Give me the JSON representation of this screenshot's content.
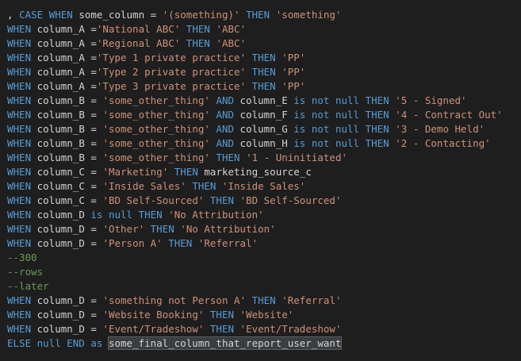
{
  "editor": {
    "lines": [
      [
        {
          "t": ", ",
          "c": "op"
        },
        {
          "t": "CASE WHEN",
          "c": "kw"
        },
        {
          "t": " some_column ",
          "c": "id"
        },
        {
          "t": "=",
          "c": "op"
        },
        {
          "t": " ",
          "c": "op"
        },
        {
          "t": "'(something)'",
          "c": "str"
        },
        {
          "t": " ",
          "c": "op"
        },
        {
          "t": "THEN",
          "c": "kw"
        },
        {
          "t": " ",
          "c": "op"
        },
        {
          "t": "'something'",
          "c": "str"
        }
      ],
      [
        {
          "t": "WHEN",
          "c": "kw"
        },
        {
          "t": " column_A ",
          "c": "id"
        },
        {
          "t": "=",
          "c": "op"
        },
        {
          "t": "'National ABC'",
          "c": "str"
        },
        {
          "t": " ",
          "c": "op"
        },
        {
          "t": "THEN",
          "c": "kw"
        },
        {
          "t": " ",
          "c": "op"
        },
        {
          "t": "'ABC'",
          "c": "str"
        }
      ],
      [
        {
          "t": "WHEN",
          "c": "kw"
        },
        {
          "t": " column_A ",
          "c": "id"
        },
        {
          "t": "=",
          "c": "op"
        },
        {
          "t": "'Regional ABC'",
          "c": "str"
        },
        {
          "t": " ",
          "c": "op"
        },
        {
          "t": "THEN",
          "c": "kw"
        },
        {
          "t": " ",
          "c": "op"
        },
        {
          "t": "'ABC'",
          "c": "str"
        }
      ],
      [
        {
          "t": "WHEN",
          "c": "kw"
        },
        {
          "t": " column_A ",
          "c": "id"
        },
        {
          "t": "=",
          "c": "op"
        },
        {
          "t": "'Type 1 private practice'",
          "c": "str"
        },
        {
          "t": " ",
          "c": "op"
        },
        {
          "t": "THEN",
          "c": "kw"
        },
        {
          "t": " ",
          "c": "op"
        },
        {
          "t": "'PP'",
          "c": "str"
        }
      ],
      [
        {
          "t": "WHEN",
          "c": "kw"
        },
        {
          "t": " column_A ",
          "c": "id"
        },
        {
          "t": "=",
          "c": "op"
        },
        {
          "t": "'Type 2 private practice'",
          "c": "str"
        },
        {
          "t": " ",
          "c": "op"
        },
        {
          "t": "THEN",
          "c": "kw"
        },
        {
          "t": " ",
          "c": "op"
        },
        {
          "t": "'PP'",
          "c": "str"
        }
      ],
      [
        {
          "t": "WHEN",
          "c": "kw"
        },
        {
          "t": " column_A ",
          "c": "id"
        },
        {
          "t": "=",
          "c": "op"
        },
        {
          "t": "'Type 3 private practice'",
          "c": "str"
        },
        {
          "t": " ",
          "c": "op"
        },
        {
          "t": "THEN",
          "c": "kw"
        },
        {
          "t": " ",
          "c": "op"
        },
        {
          "t": "'PP'",
          "c": "str"
        }
      ],
      [
        {
          "t": "WHEN",
          "c": "kw"
        },
        {
          "t": " column_B ",
          "c": "id"
        },
        {
          "t": "=",
          "c": "op"
        },
        {
          "t": " ",
          "c": "op"
        },
        {
          "t": "'some_other_thing'",
          "c": "str"
        },
        {
          "t": " ",
          "c": "op"
        },
        {
          "t": "AND",
          "c": "kw"
        },
        {
          "t": " column_E ",
          "c": "id"
        },
        {
          "t": "is not null",
          "c": "kw"
        },
        {
          "t": " ",
          "c": "op"
        },
        {
          "t": "THEN",
          "c": "kw"
        },
        {
          "t": " ",
          "c": "op"
        },
        {
          "t": "'5 - Signed'",
          "c": "str"
        }
      ],
      [
        {
          "t": "WHEN",
          "c": "kw"
        },
        {
          "t": " column_B ",
          "c": "id"
        },
        {
          "t": "=",
          "c": "op"
        },
        {
          "t": " ",
          "c": "op"
        },
        {
          "t": "'some_other_thing'",
          "c": "str"
        },
        {
          "t": " ",
          "c": "op"
        },
        {
          "t": "AND",
          "c": "kw"
        },
        {
          "t": " column_F ",
          "c": "id"
        },
        {
          "t": "is not null",
          "c": "kw"
        },
        {
          "t": " ",
          "c": "op"
        },
        {
          "t": "THEN",
          "c": "kw"
        },
        {
          "t": " ",
          "c": "op"
        },
        {
          "t": "'4 - Contract Out'",
          "c": "str"
        }
      ],
      [
        {
          "t": "WHEN",
          "c": "kw"
        },
        {
          "t": " column_B ",
          "c": "id"
        },
        {
          "t": "=",
          "c": "op"
        },
        {
          "t": " ",
          "c": "op"
        },
        {
          "t": "'some_other_thing'",
          "c": "str"
        },
        {
          "t": " ",
          "c": "op"
        },
        {
          "t": "AND",
          "c": "kw"
        },
        {
          "t": " column_G ",
          "c": "id"
        },
        {
          "t": "is not null",
          "c": "kw"
        },
        {
          "t": " ",
          "c": "op"
        },
        {
          "t": "THEN",
          "c": "kw"
        },
        {
          "t": " ",
          "c": "op"
        },
        {
          "t": "'3 - Demo Held'",
          "c": "str"
        }
      ],
      [
        {
          "t": "WHEN",
          "c": "kw"
        },
        {
          "t": " column_B ",
          "c": "id"
        },
        {
          "t": "=",
          "c": "op"
        },
        {
          "t": " ",
          "c": "op"
        },
        {
          "t": "'some_other_thing'",
          "c": "str"
        },
        {
          "t": " ",
          "c": "op"
        },
        {
          "t": "AND",
          "c": "kw"
        },
        {
          "t": " column_H ",
          "c": "id"
        },
        {
          "t": "is not null",
          "c": "kw"
        },
        {
          "t": " ",
          "c": "op"
        },
        {
          "t": "THEN",
          "c": "kw"
        },
        {
          "t": " ",
          "c": "op"
        },
        {
          "t": "'2 - Contacting'",
          "c": "str"
        }
      ],
      [
        {
          "t": "WHEN",
          "c": "kw"
        },
        {
          "t": " column_B ",
          "c": "id"
        },
        {
          "t": "=",
          "c": "op"
        },
        {
          "t": " ",
          "c": "op"
        },
        {
          "t": "'some_other_thing'",
          "c": "str"
        },
        {
          "t": " ",
          "c": "op"
        },
        {
          "t": "THEN",
          "c": "kw"
        },
        {
          "t": " ",
          "c": "op"
        },
        {
          "t": "'1 - Uninitiated'",
          "c": "str"
        }
      ],
      [
        {
          "t": "WHEN",
          "c": "kw"
        },
        {
          "t": " column_C ",
          "c": "id"
        },
        {
          "t": "=",
          "c": "op"
        },
        {
          "t": " ",
          "c": "op"
        },
        {
          "t": "'Marketing'",
          "c": "str"
        },
        {
          "t": " ",
          "c": "op"
        },
        {
          "t": "THEN",
          "c": "kw"
        },
        {
          "t": " marketing_source_c",
          "c": "id"
        }
      ],
      [
        {
          "t": "WHEN",
          "c": "kw"
        },
        {
          "t": " column_C ",
          "c": "id"
        },
        {
          "t": "=",
          "c": "op"
        },
        {
          "t": " ",
          "c": "op"
        },
        {
          "t": "'Inside Sales'",
          "c": "str"
        },
        {
          "t": " ",
          "c": "op"
        },
        {
          "t": "THEN",
          "c": "kw"
        },
        {
          "t": " ",
          "c": "op"
        },
        {
          "t": "'Inside Sales'",
          "c": "str"
        }
      ],
      [
        {
          "t": "WHEN",
          "c": "kw"
        },
        {
          "t": " column_C ",
          "c": "id"
        },
        {
          "t": "=",
          "c": "op"
        },
        {
          "t": " ",
          "c": "op"
        },
        {
          "t": "'BD Self-Sourced'",
          "c": "str"
        },
        {
          "t": " ",
          "c": "op"
        },
        {
          "t": "THEN",
          "c": "kw"
        },
        {
          "t": " ",
          "c": "op"
        },
        {
          "t": "'BD Self-Sourced'",
          "c": "str"
        }
      ],
      [
        {
          "t": "WHEN",
          "c": "kw"
        },
        {
          "t": " column_D ",
          "c": "id"
        },
        {
          "t": "is null",
          "c": "kw"
        },
        {
          "t": " ",
          "c": "op"
        },
        {
          "t": "THEN",
          "c": "kw"
        },
        {
          "t": " ",
          "c": "op"
        },
        {
          "t": "'No Attribution'",
          "c": "str"
        }
      ],
      [
        {
          "t": "WHEN",
          "c": "kw"
        },
        {
          "t": " column_D ",
          "c": "id"
        },
        {
          "t": "=",
          "c": "op"
        },
        {
          "t": " ",
          "c": "op"
        },
        {
          "t": "'Other'",
          "c": "str"
        },
        {
          "t": " ",
          "c": "op"
        },
        {
          "t": "THEN",
          "c": "kw"
        },
        {
          "t": " ",
          "c": "op"
        },
        {
          "t": "'No Attribution'",
          "c": "str"
        }
      ],
      [
        {
          "t": "WHEN",
          "c": "kw"
        },
        {
          "t": " column_D ",
          "c": "id"
        },
        {
          "t": "=",
          "c": "op"
        },
        {
          "t": " ",
          "c": "op"
        },
        {
          "t": "'Person A'",
          "c": "str"
        },
        {
          "t": " ",
          "c": "op"
        },
        {
          "t": "THEN",
          "c": "kw"
        },
        {
          "t": " ",
          "c": "op"
        },
        {
          "t": "'Referral'",
          "c": "str"
        }
      ],
      [
        {
          "t": "--300",
          "c": "cm"
        }
      ],
      [
        {
          "t": "--rows",
          "c": "cm"
        }
      ],
      [
        {
          "t": "--later",
          "c": "cm"
        }
      ],
      [
        {
          "t": "WHEN",
          "c": "kw"
        },
        {
          "t": " column_D ",
          "c": "id"
        },
        {
          "t": "=",
          "c": "op"
        },
        {
          "t": " ",
          "c": "op"
        },
        {
          "t": "'something not Person A'",
          "c": "str"
        },
        {
          "t": " ",
          "c": "op"
        },
        {
          "t": "THEN",
          "c": "kw"
        },
        {
          "t": " ",
          "c": "op"
        },
        {
          "t": "'Referral'",
          "c": "str"
        }
      ],
      [
        {
          "t": "WHEN",
          "c": "kw"
        },
        {
          "t": " column_D ",
          "c": "id"
        },
        {
          "t": "=",
          "c": "op"
        },
        {
          "t": " ",
          "c": "op"
        },
        {
          "t": "'Website Booking'",
          "c": "str"
        },
        {
          "t": " ",
          "c": "op"
        },
        {
          "t": "THEN",
          "c": "kw"
        },
        {
          "t": " ",
          "c": "op"
        },
        {
          "t": "'Website'",
          "c": "str"
        }
      ],
      [
        {
          "t": "WHEN",
          "c": "kw"
        },
        {
          "t": " column_D ",
          "c": "id"
        },
        {
          "t": "=",
          "c": "op"
        },
        {
          "t": " ",
          "c": "op"
        },
        {
          "t": "'Event/Tradeshow'",
          "c": "str"
        },
        {
          "t": " ",
          "c": "op"
        },
        {
          "t": "THEN",
          "c": "kw"
        },
        {
          "t": " ",
          "c": "op"
        },
        {
          "t": "'Event/Tradeshow'",
          "c": "str"
        }
      ],
      [
        {
          "t": "ELSE null END as",
          "c": "kw"
        },
        {
          "t": " ",
          "c": "op"
        },
        {
          "t": "some_final_column_that_report_user_want",
          "c": "id",
          "sel": true
        }
      ]
    ]
  },
  "colors": {
    "background": "#1e1e1e",
    "keyword": "#569cd6",
    "string": "#ce9178",
    "identifier": "#d4d4d4",
    "comment": "#6a9955",
    "selection": "#3a3d41"
  }
}
